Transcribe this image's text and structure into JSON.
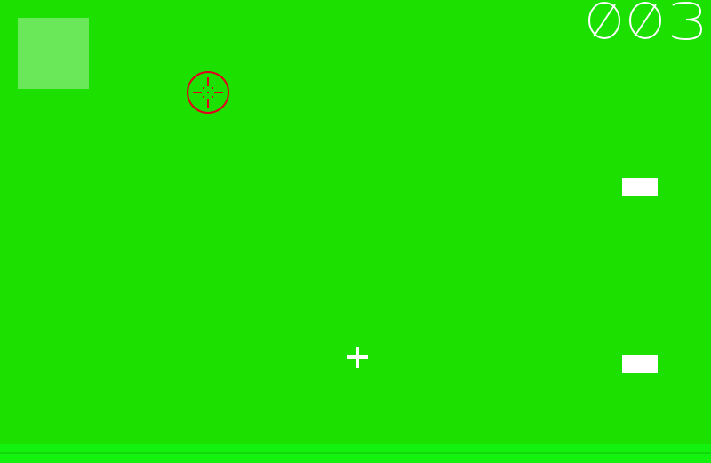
{
  "game": {
    "score_digits": [
      "0",
      "0",
      "3"
    ],
    "colors": {
      "background": "#1be000",
      "square": "#6ae85a",
      "target": "#e0001b",
      "paddle": "#ffffff",
      "cursor": "#ffffff",
      "floor": "#13f20e"
    },
    "icons": {
      "target": "crosshair-target-icon",
      "cursor": "plus-cursor-icon"
    }
  }
}
